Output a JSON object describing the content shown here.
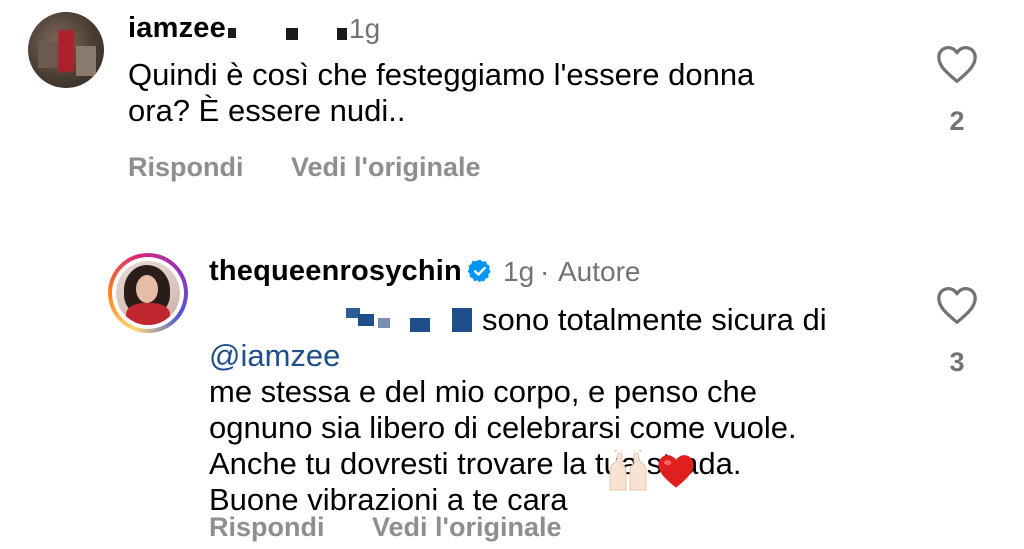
{
  "comments": [
    {
      "username": "iamzee",
      "time": "1g",
      "text": "Quindi è così che festeggiamo l'essere donna\nora? È essere nudi..",
      "likes": "2",
      "reply_label": "Rispondi",
      "translate_label": "Vedi l'originale",
      "like_icon": "heart-outline-icon"
    },
    {
      "username": "thequeenrosychin",
      "time": "1g",
      "separator": "·",
      "author_badge": "Autore",
      "mention": "@iamzee",
      "text_line1": "sono totalmente sicura di",
      "text_rest": "me stessa e del mio corpo, e penso che\nognuno sia libero di celebrarsi come vuole.\nAnche tu dovresti trovare la tua strada.\nBuone vibrazioni a te cara",
      "likes": "3",
      "reply_label": "Rispondi",
      "translate_label": "Vedi l'originale",
      "like_icon": "heart-outline-icon",
      "verified_icon": "verified-badge-icon",
      "emojis": [
        "raising-hands-icon",
        "red-heart-icon"
      ]
    }
  ],
  "colors": {
    "secondary_text": "#737373",
    "action_text": "#8e8e8e",
    "verified_blue": "#0095f6",
    "mention_blue": "#0c3f7d",
    "heart_red": "#e0201f"
  }
}
